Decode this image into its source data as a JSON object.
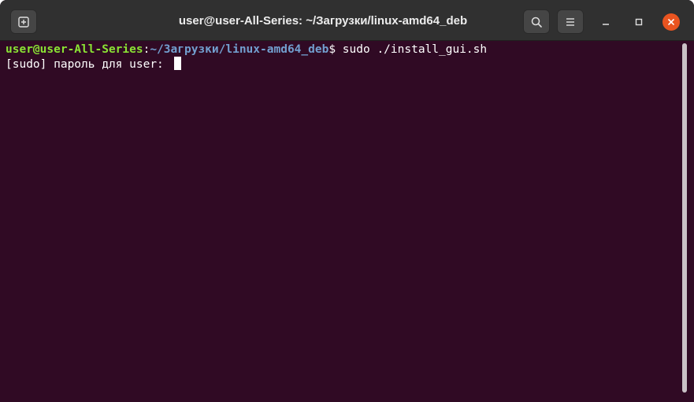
{
  "window": {
    "title": "user@user-All-Series: ~/Загрузки/linux-amd64_deb"
  },
  "titlebar": {
    "new_tab_icon": "new-tab-icon",
    "search_icon": "search-icon",
    "menu_icon": "hamburger-menu-icon",
    "minimize_icon": "minimize-icon",
    "maximize_icon": "maximize-icon",
    "close_icon": "close-icon"
  },
  "terminal": {
    "lines": [
      {
        "user_host": "user@user-All-Series",
        "separator": ":",
        "path": "~/Загрузки/linux-amd64_deb",
        "prompt": "$ ",
        "command": "sudo ./install_gui.sh"
      },
      {
        "text": "[sudo] пароль для user: "
      }
    ]
  },
  "colors": {
    "terminal_bg": "#300a24",
    "titlebar_bg": "#303030",
    "user_host": "#8ae234",
    "path": "#729fcf",
    "close_button": "#e95420"
  }
}
